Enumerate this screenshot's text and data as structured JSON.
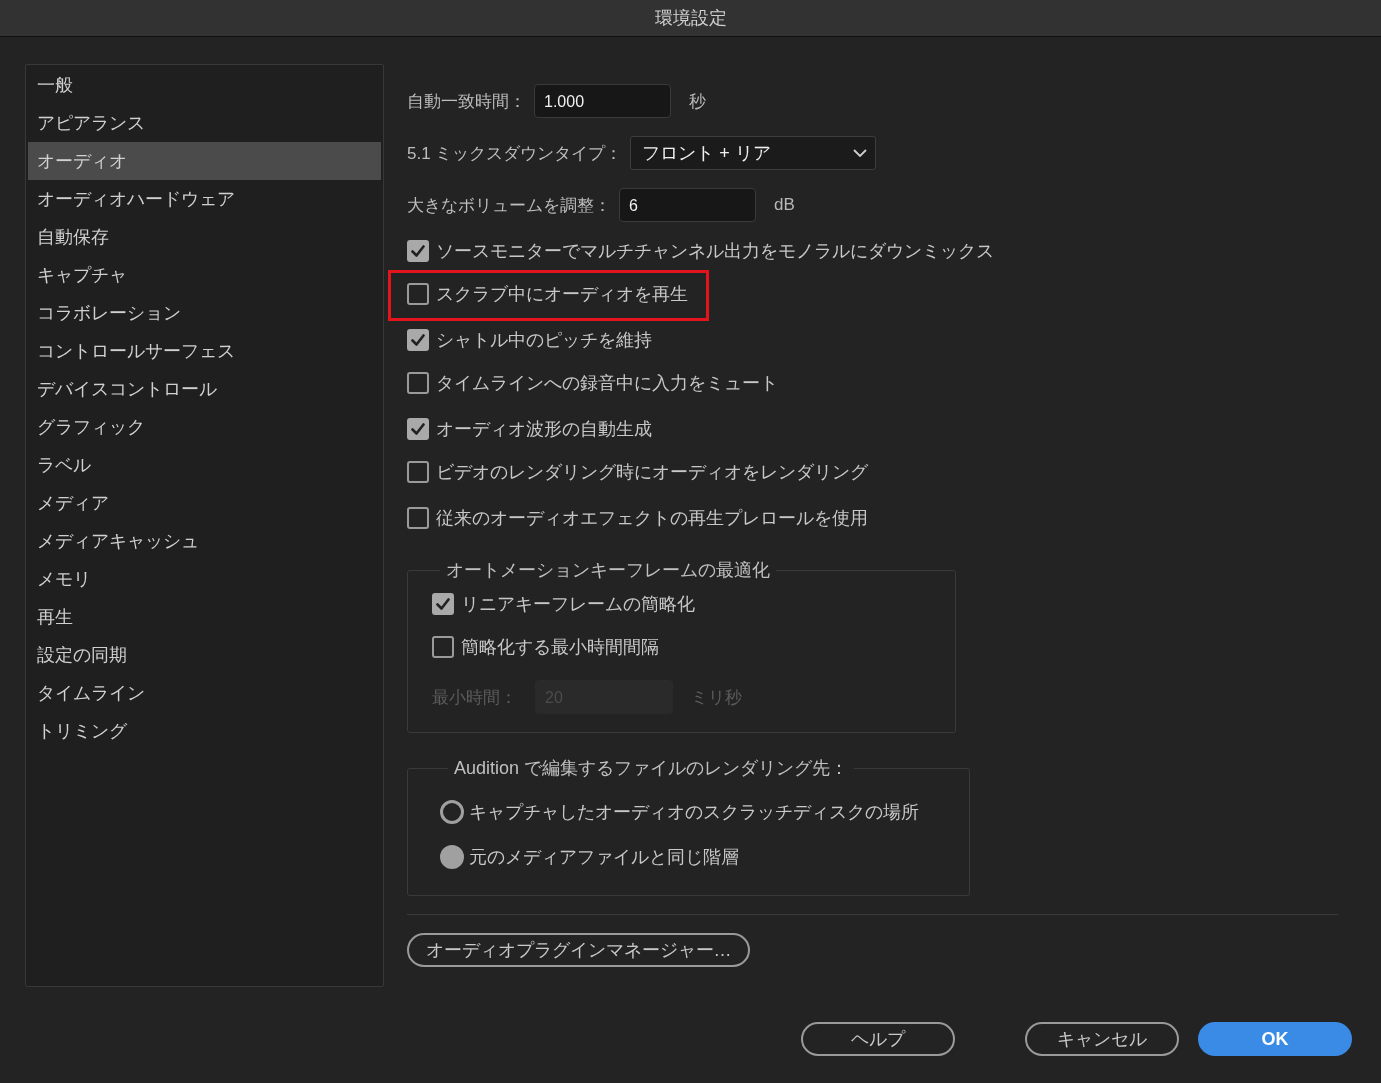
{
  "window": {
    "title": "環境設定"
  },
  "sidebar": {
    "items": [
      {
        "label": "一般",
        "selected": false
      },
      {
        "label": "アピアランス",
        "selected": false
      },
      {
        "label": "オーディオ",
        "selected": true
      },
      {
        "label": "オーディオハードウェア",
        "selected": false
      },
      {
        "label": "自動保存",
        "selected": false
      },
      {
        "label": "キャプチャ",
        "selected": false
      },
      {
        "label": "コラボレーション",
        "selected": false
      },
      {
        "label": "コントロールサーフェス",
        "selected": false
      },
      {
        "label": "デバイスコントロール",
        "selected": false
      },
      {
        "label": "グラフィック",
        "selected": false
      },
      {
        "label": "ラベル",
        "selected": false
      },
      {
        "label": "メディア",
        "selected": false
      },
      {
        "label": "メディアキャッシュ",
        "selected": false
      },
      {
        "label": "メモリ",
        "selected": false
      },
      {
        "label": "再生",
        "selected": false
      },
      {
        "label": "設定の同期",
        "selected": false
      },
      {
        "label": "タイムライン",
        "selected": false
      },
      {
        "label": "トリミング",
        "selected": false
      }
    ]
  },
  "fields": [
    {
      "kind": "text",
      "label": "自動一致時間：",
      "value": "1.000",
      "unit": "秒"
    },
    {
      "kind": "dropdown",
      "label": "5.1 ミックスダウンタイプ：",
      "value": "フロント + リア"
    },
    {
      "kind": "text",
      "label": "大きなボリュームを調整：",
      "value": "6",
      "unit": "dB"
    }
  ],
  "checkboxes": [
    {
      "label": "ソースモニターでマルチチャンネル出力をモノラルにダウンミックス",
      "checked": true,
      "highlighted": false
    },
    {
      "label": "スクラブ中にオーディオを再生",
      "checked": false,
      "highlighted": true
    },
    {
      "label": "シャトル中のピッチを維持",
      "checked": true,
      "highlighted": false
    },
    {
      "label": "タイムラインへの録音中に入力をミュート",
      "checked": false,
      "highlighted": false
    },
    {
      "label": "オーディオ波形の自動生成",
      "checked": true,
      "highlighted": false
    },
    {
      "label": "ビデオのレンダリング時にオーディオをレンダリング",
      "checked": false,
      "highlighted": false
    },
    {
      "label": "従来のオーディオエフェクトの再生プレロールを使用",
      "checked": false,
      "highlighted": false
    }
  ],
  "automation_group": {
    "title": "オートメーションキーフレームの最適化",
    "checkboxes": [
      {
        "label": "リニアキーフレームの簡略化",
        "checked": true,
        "highlighted": false
      },
      {
        "label": "簡略化する最小時間間隔",
        "checked": false,
        "highlighted": false
      }
    ],
    "min_time": {
      "label": "最小時間：",
      "value": "20",
      "unit": "ミリ秒",
      "disabled": true
    }
  },
  "render_group": {
    "title": "Audition で編集するファイルのレンダリング先：",
    "options": [
      {
        "label": "キャプチャしたオーディオのスクラッチディスクの場所",
        "selected": false
      },
      {
        "label": "元のメディアファイルと同じ階層",
        "selected": true
      }
    ]
  },
  "plugin_button": "オーディオプラグインマネージャー…",
  "buttons": [
    {
      "label": "ヘルプ",
      "kind": "secondary"
    },
    {
      "label": "キャンセル",
      "kind": "secondary"
    },
    {
      "label": "OK",
      "kind": "primary"
    }
  ]
}
